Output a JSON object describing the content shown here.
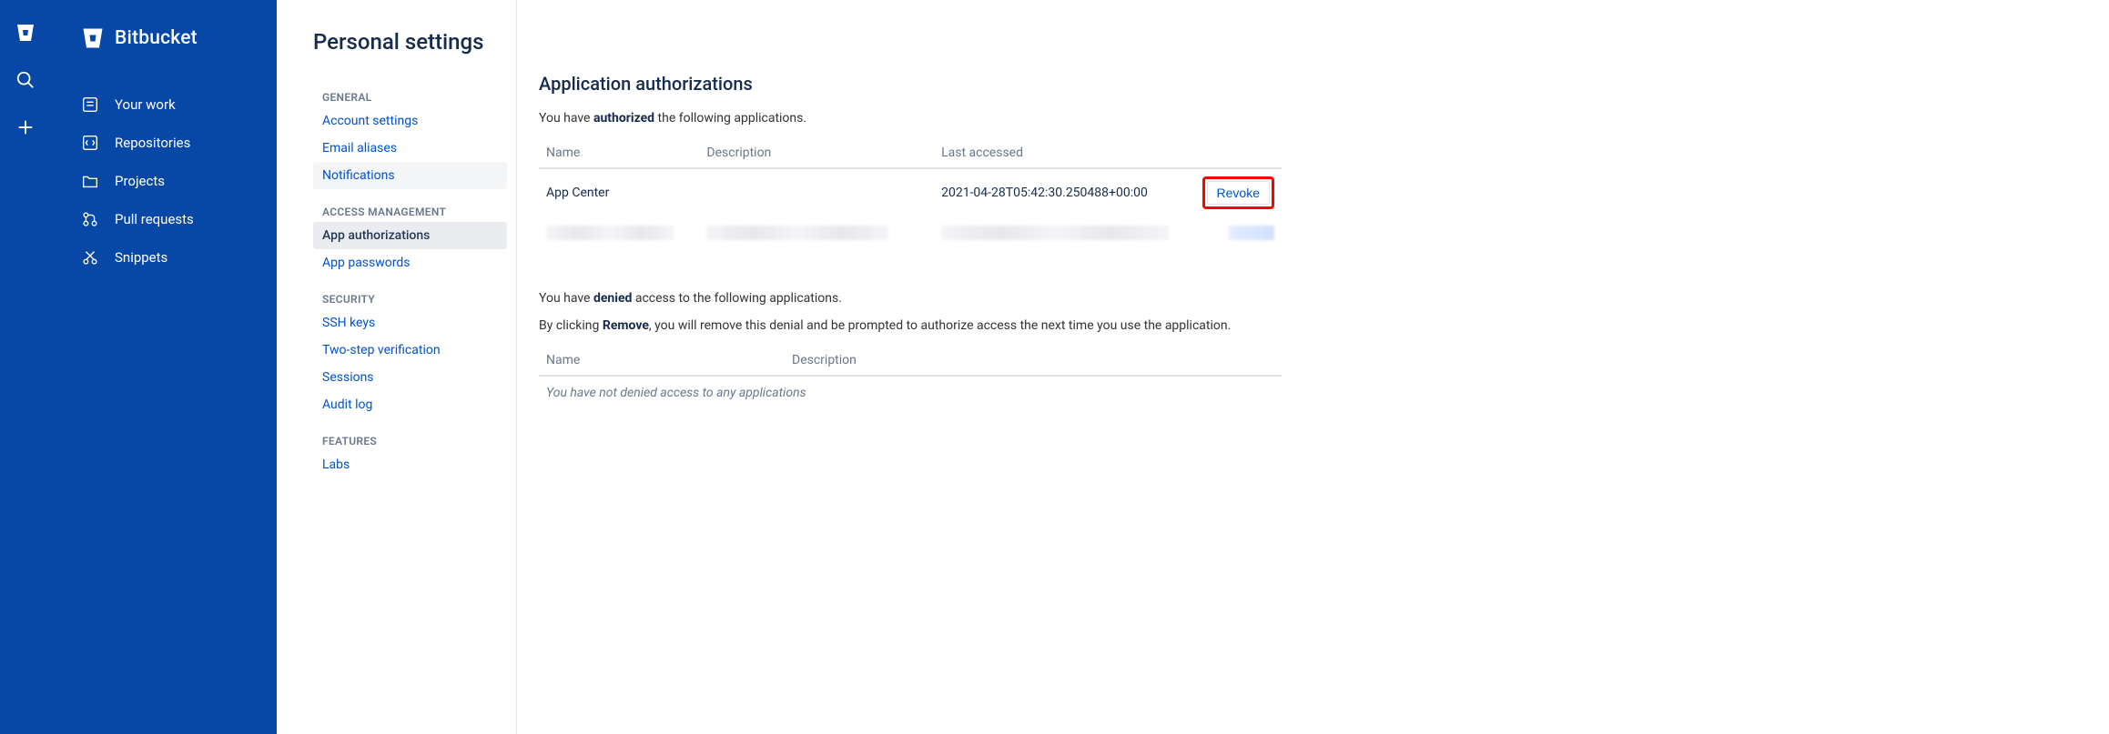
{
  "product": {
    "name": "Bitbucket"
  },
  "primaryNav": [
    {
      "label": "Your work"
    },
    {
      "label": "Repositories"
    },
    {
      "label": "Projects"
    },
    {
      "label": "Pull requests"
    },
    {
      "label": "Snippets"
    }
  ],
  "pageTitle": "Personal settings",
  "settingsNav": {
    "general": {
      "heading": "GENERAL",
      "items": [
        {
          "label": "Account settings"
        },
        {
          "label": "Email aliases"
        },
        {
          "label": "Notifications"
        }
      ]
    },
    "access": {
      "heading": "ACCESS MANAGEMENT",
      "items": [
        {
          "label": "App authorizations"
        },
        {
          "label": "App passwords"
        }
      ]
    },
    "security": {
      "heading": "SECURITY",
      "items": [
        {
          "label": "SSH keys"
        },
        {
          "label": "Two-step verification"
        },
        {
          "label": "Sessions"
        },
        {
          "label": "Audit log"
        }
      ]
    },
    "features": {
      "heading": "FEATURES",
      "items": [
        {
          "label": "Labs"
        }
      ]
    }
  },
  "content": {
    "heading": "Application authorizations",
    "authorizedIntro": {
      "pre": "You have ",
      "bold": "authorized",
      "post": " the following applications."
    },
    "authTable": {
      "headers": {
        "name": "Name",
        "description": "Description",
        "lastAccessed": "Last accessed"
      },
      "rows": [
        {
          "name": "App Center",
          "description": "",
          "lastAccessed": "2021-04-28T05:42:30.250488+00:00",
          "action": "Revoke"
        }
      ]
    },
    "deniedIntro": {
      "pre": "You have ",
      "bold": "denied",
      "post": " access to the following applications."
    },
    "removeNote": {
      "pre": "By clicking ",
      "bold": "Remove",
      "post": ", you will remove this denial and be prompted to authorize access the next time you use the application."
    },
    "deniedTable": {
      "headers": {
        "name": "Name",
        "description": "Description"
      },
      "empty": "You have not denied access to any applications"
    }
  }
}
